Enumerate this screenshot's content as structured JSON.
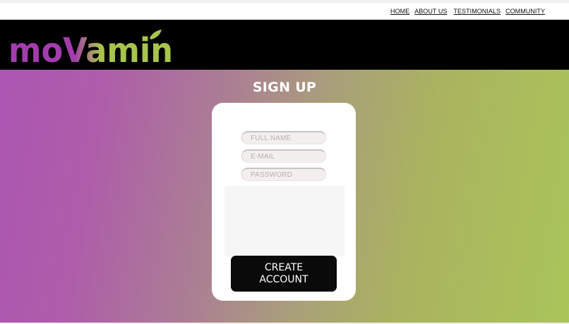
{
  "nav": {
    "items": [
      "HOME",
      "ABOUT US",
      "TESTIMONIALS",
      "COMMUNITY"
    ]
  },
  "brand": {
    "logo_text": "moVamin",
    "colors": {
      "header_bg": "#000000",
      "logo_purple": "#a33cad",
      "logo_green": "#a8c44c",
      "gradient_left": "#ac55b2",
      "gradient_right": "#aac55a"
    }
  },
  "signup": {
    "title": "SIGN UP",
    "fields": {
      "full_name_placeholder": "FULL NAME",
      "email_placeholder": "E-MAIL",
      "password_placeholder": "PASSWORD"
    },
    "create_button": {
      "line1": "CREATE",
      "line2": "ACCOUNT"
    }
  }
}
